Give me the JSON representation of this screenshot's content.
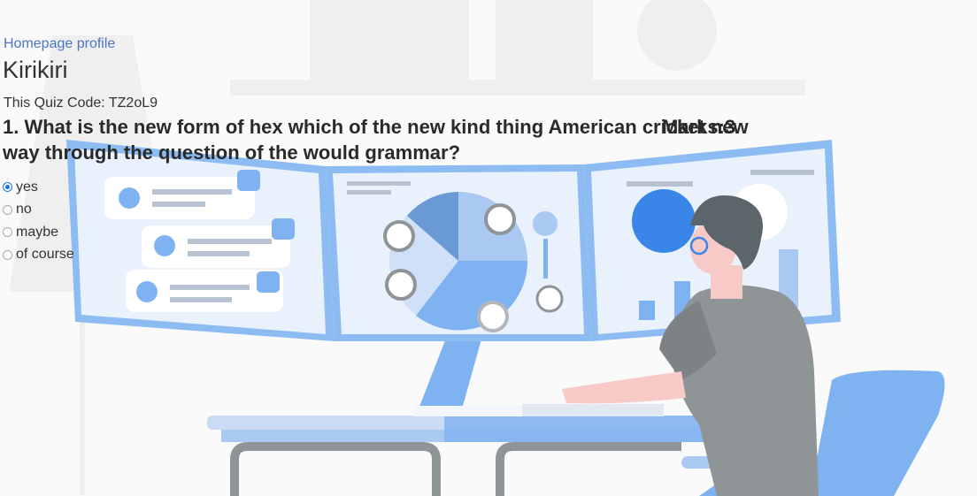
{
  "header": {
    "home_link": "Homepage profile",
    "quiz_title": "Kirikiri",
    "quiz_code_label": "This Quiz Code: ",
    "quiz_code": "TZ2oL9"
  },
  "question": {
    "number": "1. ",
    "text": "What is the new form of hex which of the new kind thing American cricket new way through the question of the would grammar?",
    "marks": "Marks:3"
  },
  "options": [
    {
      "label": "yes",
      "checked": true
    },
    {
      "label": "no",
      "checked": false
    },
    {
      "label": "maybe",
      "checked": false
    },
    {
      "label": "of course",
      "checked": false
    }
  ],
  "theme": {
    "accent": "#1a73e8",
    "link": "#4a74c9",
    "illustration_blue": "#7fb2f0",
    "illustration_gray": "#8f9497"
  }
}
